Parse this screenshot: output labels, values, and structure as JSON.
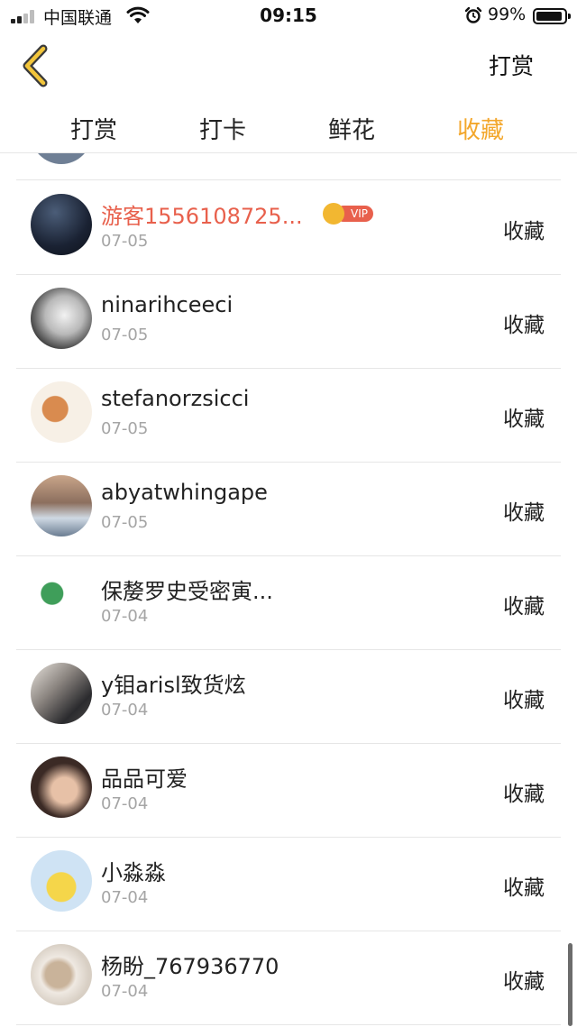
{
  "status_bar": {
    "carrier": "中国联通",
    "time": "09:15",
    "battery": "99%"
  },
  "nav": {
    "right_button": "打赏"
  },
  "tabs": [
    {
      "label": "打赏"
    },
    {
      "label": "打卡"
    },
    {
      "label": "鲜花"
    },
    {
      "label": "收藏"
    }
  ],
  "vip_label": "VIP",
  "items": [
    {
      "name": "游客1556108725...",
      "date": "07-05",
      "action": "收藏"
    },
    {
      "name": "ninarihceeci",
      "date": "07-05",
      "action": "收藏"
    },
    {
      "name": "stefanorzsicci",
      "date": "07-05",
      "action": "收藏"
    },
    {
      "name": "abyatwhingape",
      "date": "07-05",
      "action": "收藏"
    },
    {
      "name": "保嫠罗史受密寅...",
      "date": "07-04",
      "action": "收藏"
    },
    {
      "name": "y钼arisl致货炫",
      "date": "07-04",
      "action": "收藏"
    },
    {
      "name": "品品可爱",
      "date": "07-04",
      "action": "收藏"
    },
    {
      "name": "小淼淼",
      "date": "07-04",
      "action": "收藏"
    },
    {
      "name": "杨盼_767936770",
      "date": "07-04",
      "action": "收藏"
    }
  ],
  "colors": {
    "accent": "#f3a72c",
    "vip_name": "#e8604c",
    "date": "#a5a5a5",
    "divider": "#e6e6e6"
  }
}
